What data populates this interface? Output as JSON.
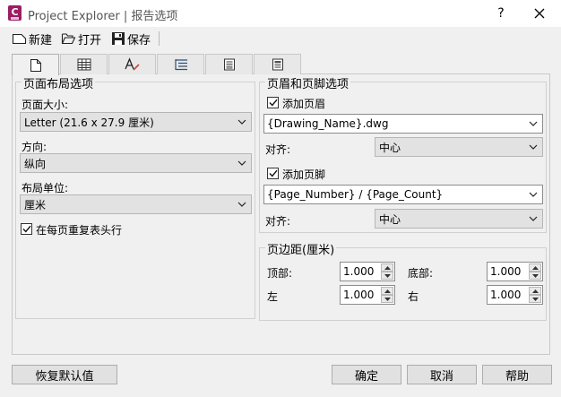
{
  "window": {
    "title": "Project Explorer | 报告选项",
    "help_label": "?",
    "logo_letter": "C"
  },
  "toolbar": {
    "new_label": "新建",
    "open_label": "打开",
    "save_label": "保存"
  },
  "tabs": [
    {
      "icon": "page-layout-icon",
      "active": true
    },
    {
      "icon": "table-columns-icon",
      "active": false
    },
    {
      "icon": "font-style-icon",
      "active": false
    },
    {
      "icon": "list-indent-icon",
      "active": false
    },
    {
      "icon": "report-detail-icon",
      "active": false
    },
    {
      "icon": "report-summary-icon",
      "active": false
    }
  ],
  "page_layout": {
    "group_title": "页面布局选项",
    "page_size_label": "页面大小:",
    "page_size_value": "Letter (21.6 x 27.9 厘米)",
    "orientation_label": "方向:",
    "orientation_value": "纵向",
    "units_label": "布局单位:",
    "units_value": "厘米",
    "repeat_header_label": "在每页重复表头行",
    "repeat_header_checked": true
  },
  "header_footer": {
    "group_title": "页眉和页脚选项",
    "add_header_label": "添加页眉",
    "add_header_checked": true,
    "header_value": "{Drawing_Name}.dwg",
    "header_align_label": "对齐:",
    "header_align_value": "中心",
    "add_footer_label": "添加页脚",
    "add_footer_checked": true,
    "footer_value": "{Page_Number} / {Page_Count}",
    "footer_align_label": "对齐:",
    "footer_align_value": "中心"
  },
  "margins": {
    "group_title": "页边距(厘米)",
    "top_label": "顶部:",
    "top_value": "1.000",
    "bottom_label": "底部:",
    "bottom_value": "1.000",
    "left_label": "左",
    "left_value": "1.000",
    "right_label": "右",
    "right_value": "1.000"
  },
  "footer_buttons": {
    "restore_label": "恢复默认值",
    "ok_label": "确定",
    "cancel_label": "取消",
    "help_label": "帮助"
  },
  "colors": {
    "logo": "#9b1e63",
    "window_bg": "#f0f0f0"
  }
}
